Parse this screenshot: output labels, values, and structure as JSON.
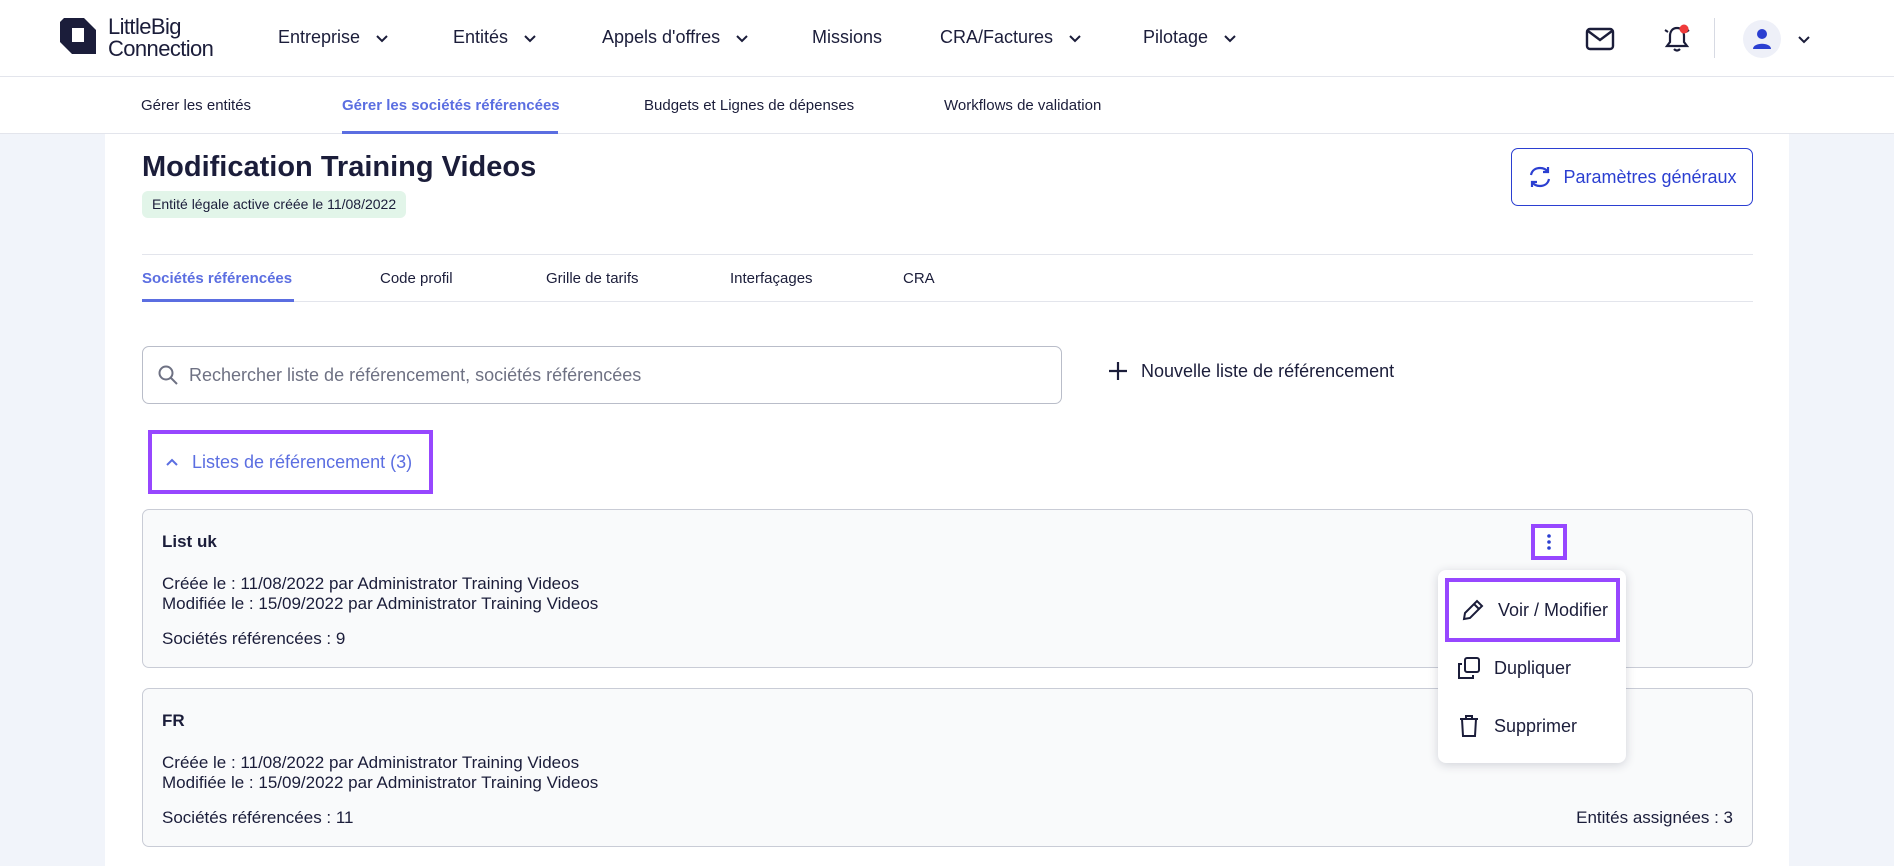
{
  "app": {
    "logo_line1": "LittleBig",
    "logo_line2": "Connection"
  },
  "topnav": {
    "items": [
      {
        "label": "Entreprise",
        "dropdown": true
      },
      {
        "label": "Entités",
        "dropdown": true
      },
      {
        "label": "Appels d'offres",
        "dropdown": true
      },
      {
        "label": "Missions",
        "dropdown": false
      },
      {
        "label": "CRA/Factures",
        "dropdown": true
      },
      {
        "label": "Pilotage",
        "dropdown": true
      }
    ],
    "icons": [
      "mail-icon",
      "bell-icon",
      "user-icon",
      "chevron-down-icon"
    ]
  },
  "subnav": {
    "items": [
      {
        "label": "Gérer les entités"
      },
      {
        "label": "Gérer les sociétés référencées",
        "active": true
      },
      {
        "label": "Budgets et Lignes de dépenses"
      },
      {
        "label": "Workflows de validation"
      }
    ]
  },
  "page": {
    "title": "Modification Training Videos",
    "status_badge": "Entité légale active créée le 11/08/2022",
    "params_button": "Paramètres généraux"
  },
  "tabs": [
    {
      "label": "Sociétés référencées",
      "active": true
    },
    {
      "label": "Code profil"
    },
    {
      "label": "Grille de tarifs"
    },
    {
      "label": "Interfaçages"
    },
    {
      "label": "CRA"
    }
  ],
  "search": {
    "placeholder": "Rechercher liste de référencement, sociétés référencées",
    "value": ""
  },
  "new_list_button": "Nouvelle liste de référencement",
  "lists_toggle": "Listes de référencement (3)",
  "lists": [
    {
      "name": "List uk",
      "created": "Créée le : 11/08/2022 par Administrator Training Videos",
      "modified": "Modifiée le : 15/09/2022 par Administrator Training Videos",
      "companies": "Sociétés référencées : 9"
    },
    {
      "name": "FR",
      "created": "Créée le : 11/08/2022 par Administrator Training Videos",
      "modified": "Modifiée le : 15/09/2022 par Administrator Training Videos",
      "companies": "Sociétés référencées : 11",
      "assigned": "Entités assignées : 3"
    }
  ],
  "context_menu": {
    "items": [
      {
        "label": "Voir / Modifier",
        "icon": "pencil-icon"
      },
      {
        "label": "Dupliquer",
        "icon": "copy-icon"
      },
      {
        "label": "Supprimer",
        "icon": "trash-icon"
      }
    ]
  },
  "colors": {
    "accent": "#5b6ee1",
    "primary_button": "#2b3fd1",
    "highlight": "#9747ff",
    "badge_bg": "#e2f5e9",
    "notification_dot": "#ef3b3b"
  }
}
